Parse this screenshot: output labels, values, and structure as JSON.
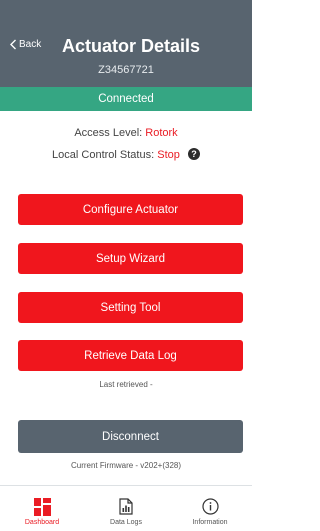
{
  "header": {
    "back_label": "Back",
    "title": "Actuator Details",
    "serial": "Z34567721"
  },
  "status": {
    "connection": "Connected"
  },
  "info": {
    "access_label": "Access Level:",
    "access_value": "Rotork",
    "local_control_label": "Local Control Status:",
    "local_control_value": "Stop"
  },
  "actions": {
    "configure": "Configure Actuator",
    "setup_wizard": "Setup Wizard",
    "setting_tool": "Setting Tool",
    "retrieve_log": "Retrieve Data Log",
    "last_retrieved": "Last retrieved -",
    "disconnect": "Disconnect",
    "firmware": "Current Firmware - v202+(328)"
  },
  "tabs": [
    {
      "label": "Dashboard",
      "icon": "dashboard-icon",
      "active": true
    },
    {
      "label": "Data Logs",
      "icon": "data-logs-icon",
      "active": false
    },
    {
      "label": "Information",
      "icon": "info-icon",
      "active": false
    }
  ],
  "colors": {
    "header": "#58646f",
    "connected": "#35a683",
    "action_red": "#f0161d",
    "highlight_text": "#ea1c24"
  }
}
